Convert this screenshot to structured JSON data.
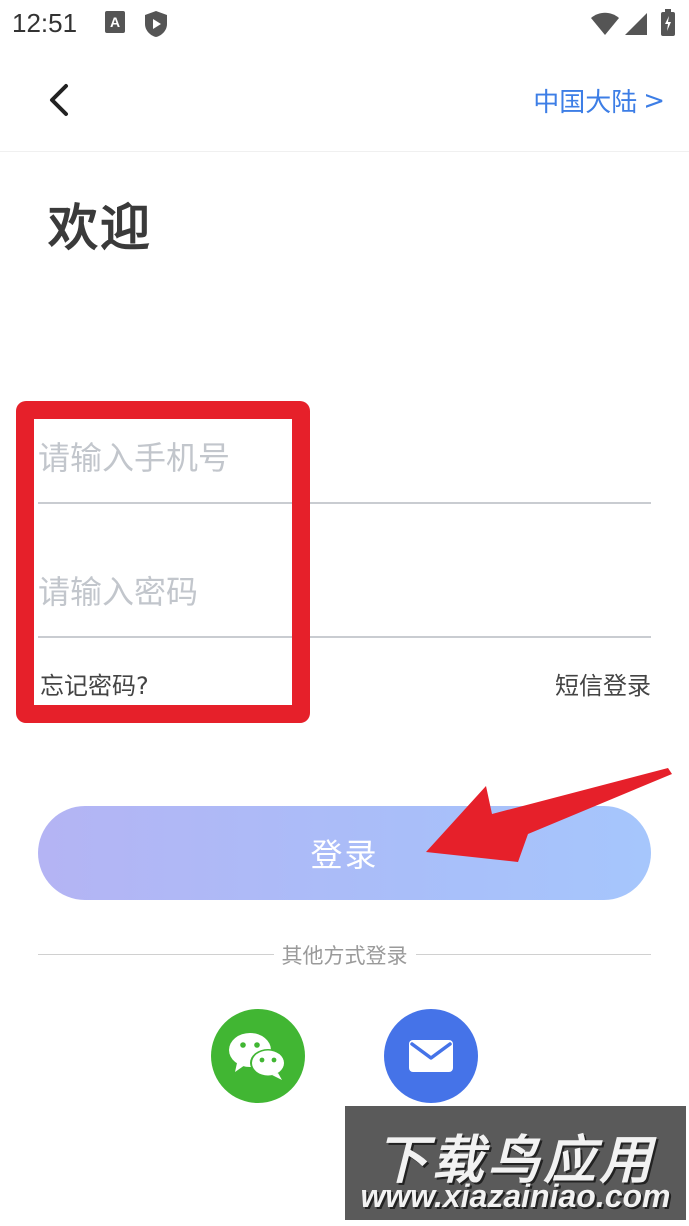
{
  "status_bar": {
    "time": "12:51",
    "left_icons": [
      "a-icon",
      "shield-play-icon"
    ],
    "right_icons": [
      "wifi-icon",
      "signal-icon",
      "battery-icon"
    ]
  },
  "nav": {
    "back_icon": "chevron-left-icon",
    "region_label": "中国大陆",
    "region_chevron": ">"
  },
  "title": "欢迎",
  "form": {
    "phone_placeholder": "请输入手机号",
    "phone_value": "",
    "password_placeholder": "请输入密码",
    "password_value": "",
    "forgot_password": "忘记密码?",
    "sms_login": "短信登录"
  },
  "login_button": "登录",
  "other_login_label": "其他方式登录",
  "social_logins": [
    {
      "name": "wechat",
      "icon": "wechat-icon",
      "color": "#41b633"
    },
    {
      "name": "email",
      "icon": "mail-icon",
      "color": "#4573e8"
    }
  ],
  "annotation": {
    "box_color": "#e6202a",
    "arrow_color": "#e6202a"
  },
  "watermark": {
    "title": "下载鸟应用",
    "url": "www.xiazainiao.com"
  },
  "colors": {
    "link": "#3d7ee6",
    "button_gradient_start": "#b4b4f4",
    "button_gradient_end": "#a6c6fc"
  }
}
